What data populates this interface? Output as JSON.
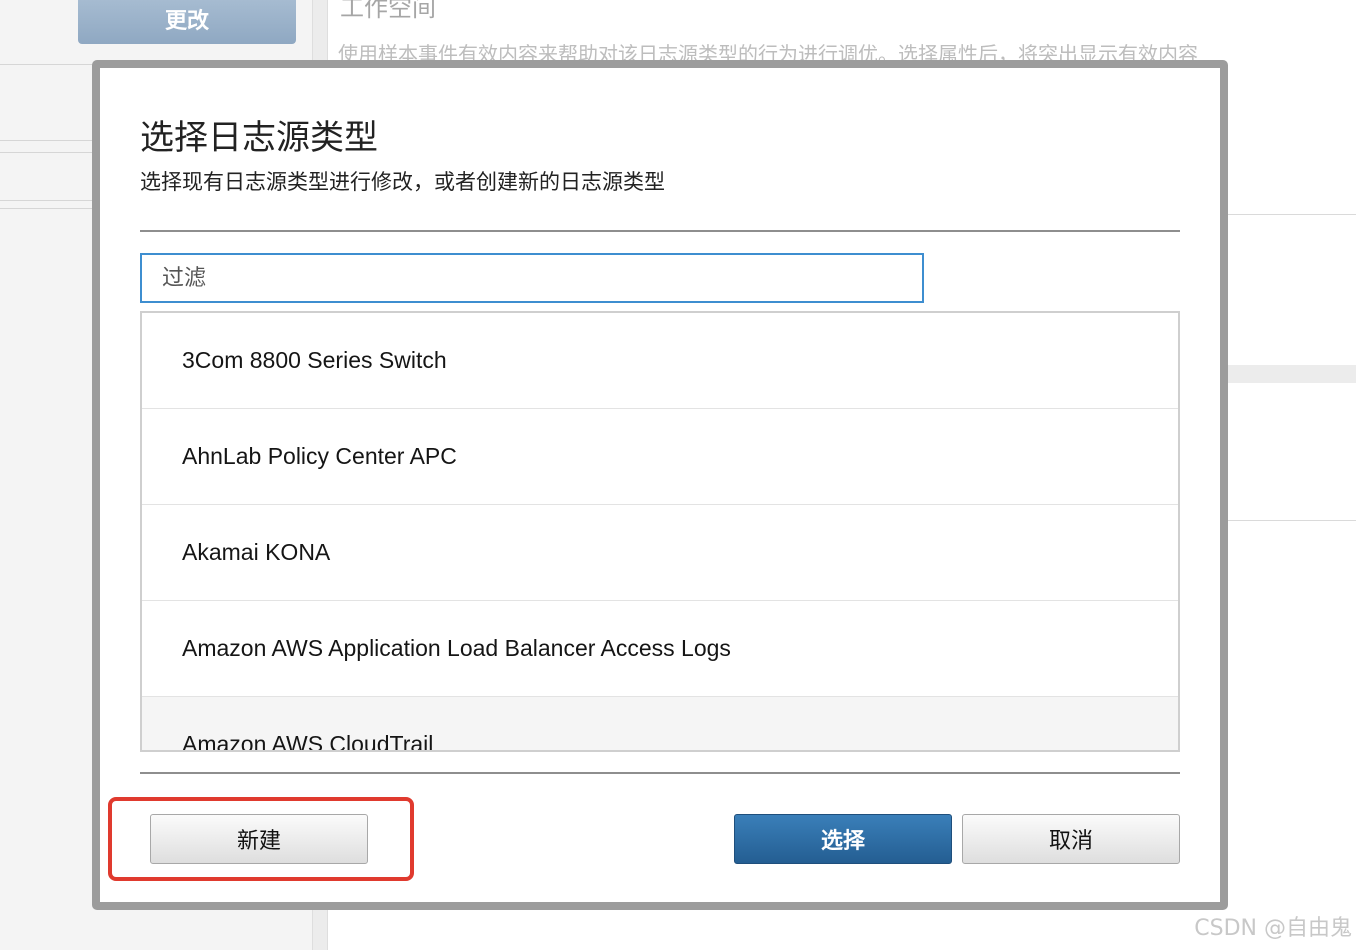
{
  "background": {
    "change_button_label": "更改",
    "workspace_title": "工作空间",
    "workspace_description": "使用样本事件有效内容来帮助对该日志源类型的行为进行调优。选择属性后，将突出显示有效内容"
  },
  "dialog": {
    "title": "选择日志源类型",
    "subtitle": "选择现有日志源类型进行修改，或者创建新的日志源类型",
    "filter_placeholder": "过滤",
    "items": [
      "3Com 8800 Series Switch",
      "AhnLab Policy Center APC",
      "Akamai KONA",
      "Amazon AWS Application Load Balancer Access Logs",
      "Amazon AWS CloudTrail"
    ],
    "new_button_label": "新建",
    "select_button_label": "选择",
    "cancel_button_label": "取消"
  },
  "annotation": {
    "highlight_color": "#e03a2e"
  },
  "watermark": "CSDN @自由鬼",
  "colors": {
    "primary_button": "#2d6ea6",
    "input_focus_border": "#3e8ed0"
  }
}
